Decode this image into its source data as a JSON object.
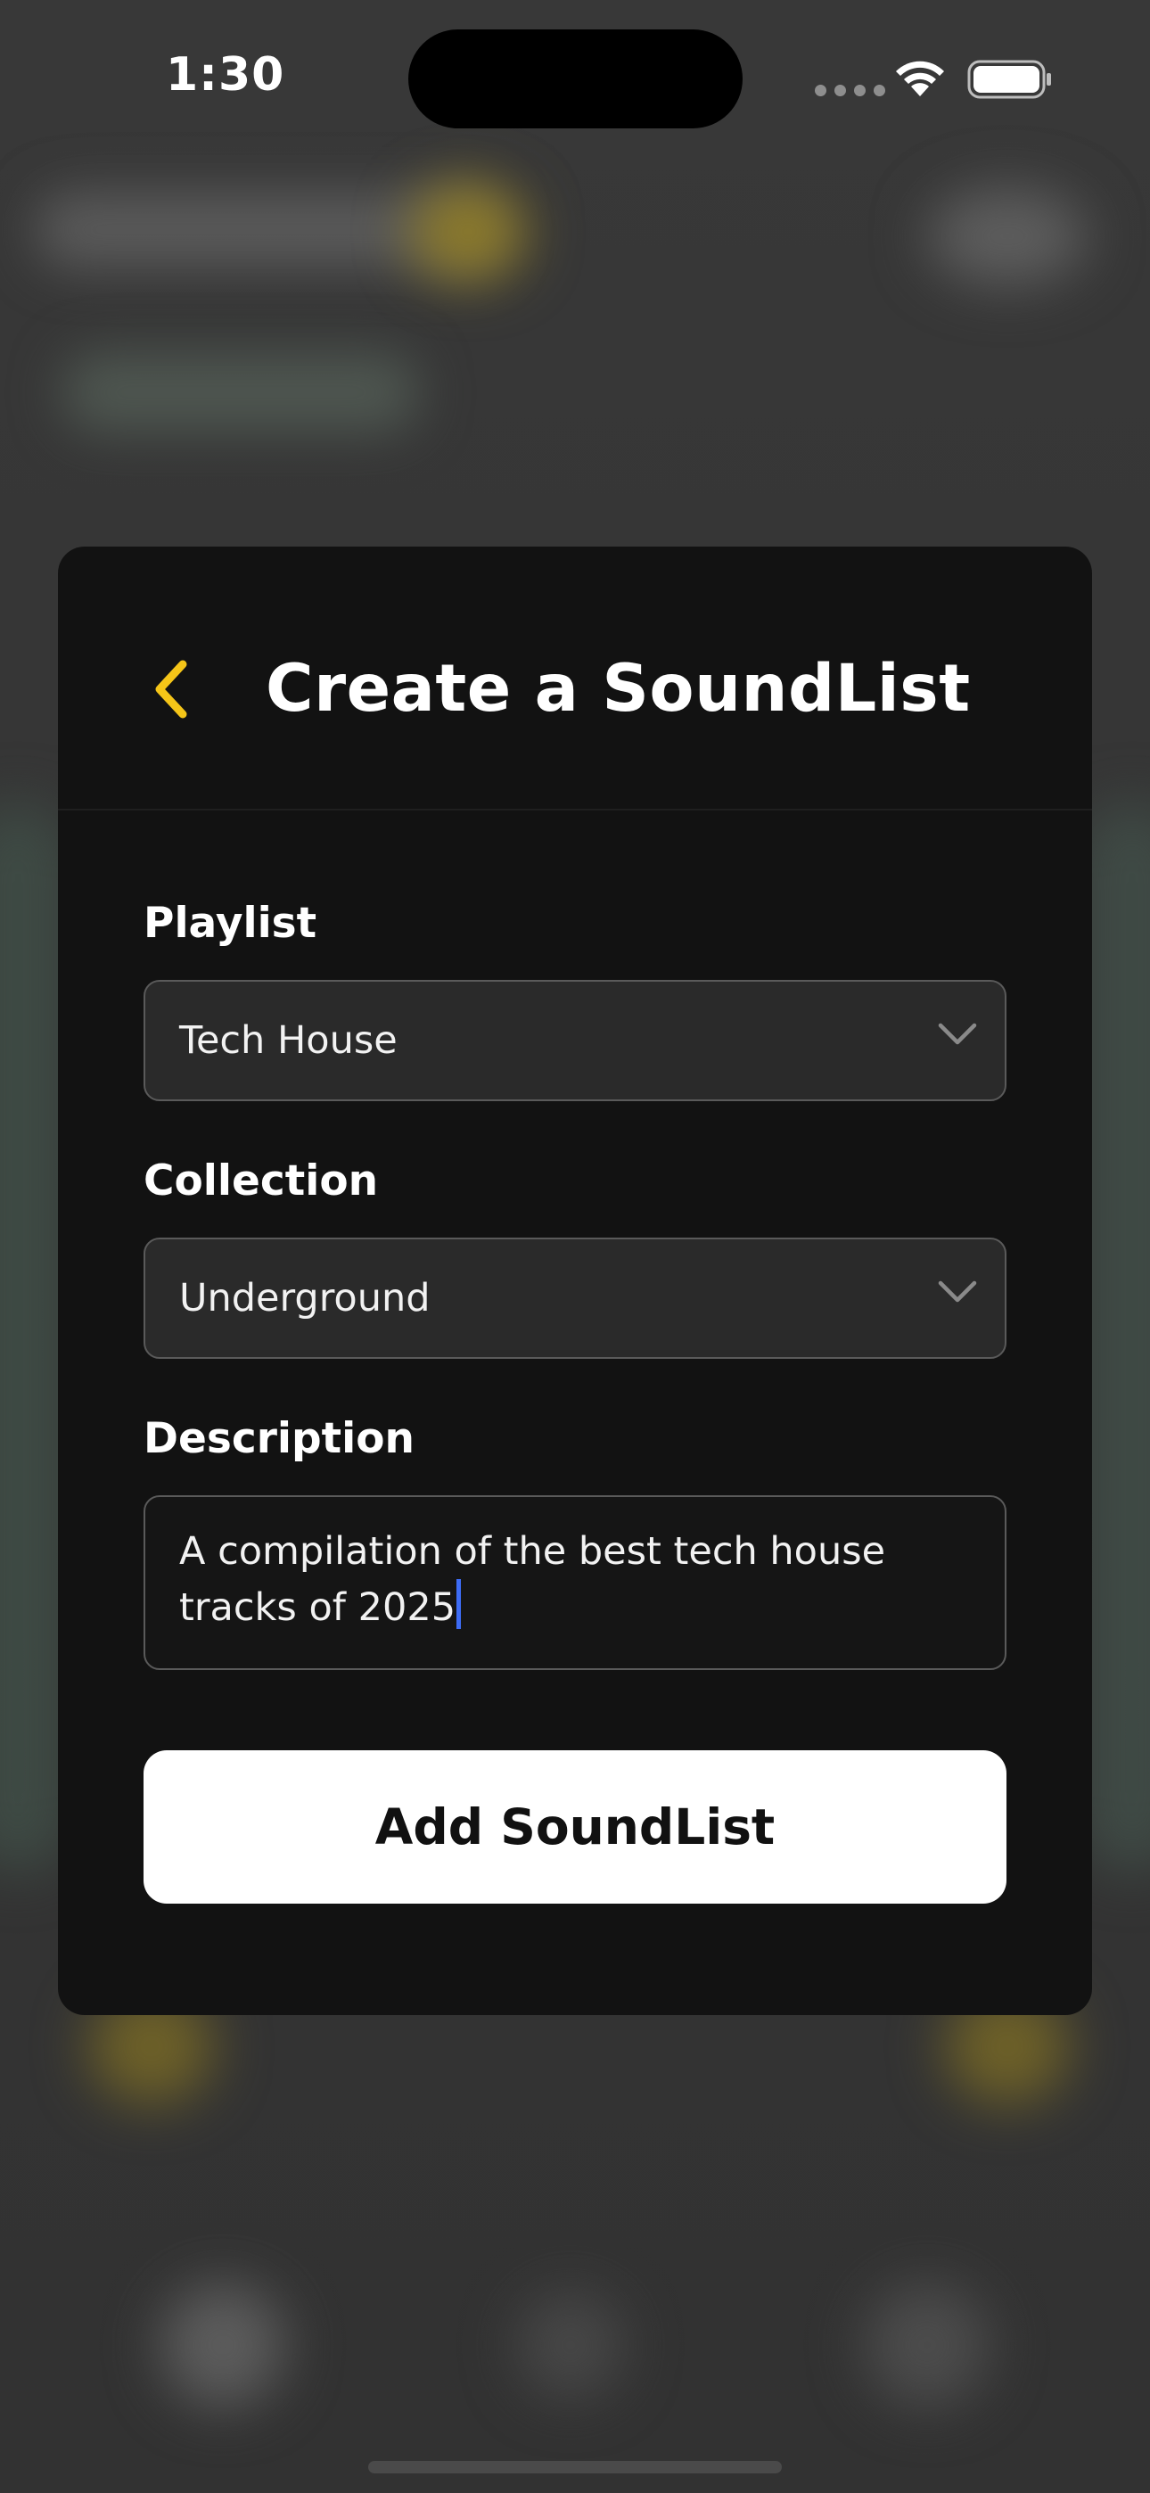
{
  "status_bar": {
    "time": "1:30"
  },
  "modal": {
    "title": "Create a SoundList",
    "back_icon": "chevron-left-icon",
    "accent_color": "#F5C518",
    "fields": {
      "playlist": {
        "label": "Playlist",
        "value": "Tech House"
      },
      "collection": {
        "label": "Collection",
        "value": "Underground"
      },
      "description": {
        "label": "Description",
        "value": "A compilation of the best tech house tracks of 2025"
      }
    },
    "submit_label": "Add SoundList"
  }
}
